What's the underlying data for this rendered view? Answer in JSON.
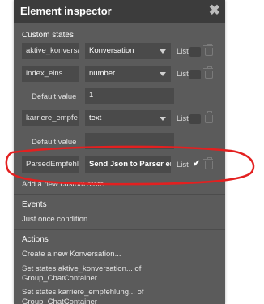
{
  "window": {
    "title": "Element inspector"
  },
  "custom_states": {
    "heading": "Custom states",
    "list_label": "List",
    "default_value_label": "Default value",
    "rows": [
      {
        "name": "aktive_konversa",
        "type": "Konversation",
        "default": null
      },
      {
        "name": "index_eins",
        "type": "number",
        "default": "1"
      },
      {
        "name": "karriere_empfe",
        "type": "text",
        "default": ""
      },
      {
        "name": "ParsedEmpfehl",
        "type": "Send Json to Parser em",
        "default": null
      }
    ],
    "add_link": "Add a new custom state"
  },
  "events": {
    "heading": "Events",
    "items": [
      "Just once condition"
    ]
  },
  "actions": {
    "heading": "Actions",
    "items": [
      "Create a new Konversation...",
      "Set states aktive_konversation... of",
      "Group_ChatContainer",
      "Set states karriere_empfehlung... of",
      "Group_ChatContainer"
    ]
  },
  "colors": {
    "panel": "#5b5b5b",
    "titlebar": "#3c3c3c",
    "field": "#4a4a4a",
    "annotation": "#e32020"
  }
}
